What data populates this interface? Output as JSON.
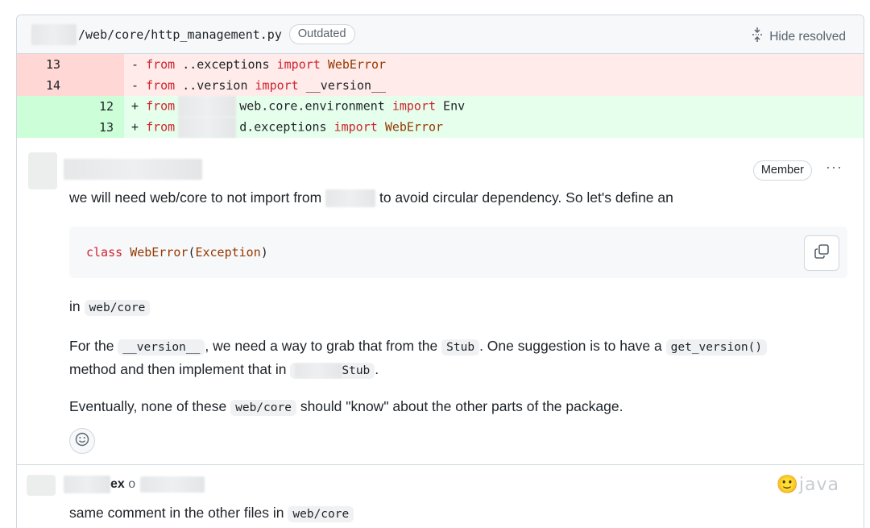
{
  "file": {
    "path": "/web/core/http_management.py",
    "badge": "Outdated",
    "hide_resolved": "Hide resolved"
  },
  "diff": [
    {
      "type": "del",
      "old": "13",
      "new": "",
      "sign": "-",
      "parts": [
        [
          "kw",
          "from"
        ],
        [
          "txt",
          " ..exceptions "
        ],
        [
          "kw",
          "import"
        ],
        [
          "txt",
          " "
        ],
        [
          "tp",
          "WebError"
        ]
      ]
    },
    {
      "type": "del",
      "old": "14",
      "new": "",
      "sign": "-",
      "parts": [
        [
          "kw",
          "from"
        ],
        [
          "txt",
          " ..version "
        ],
        [
          "kw",
          "import"
        ],
        [
          "txt",
          " __version__"
        ]
      ]
    },
    {
      "type": "add",
      "old": "",
      "new": "12",
      "sign": "+",
      "parts": [
        [
          "kw",
          "from"
        ],
        [
          "blur",
          ""
        ],
        [
          "txt",
          "web.core.environment "
        ],
        [
          "kw",
          "import"
        ],
        [
          "txt",
          " Env"
        ]
      ]
    },
    {
      "type": "add",
      "old": "",
      "new": "13",
      "sign": "+",
      "parts": [
        [
          "kw",
          "from"
        ],
        [
          "blur",
          ""
        ],
        [
          "txt",
          "d.exceptions "
        ],
        [
          "kw",
          "import"
        ],
        [
          "txt",
          " "
        ],
        [
          "tp",
          "WebError"
        ]
      ]
    }
  ],
  "comment1": {
    "badge": "Member",
    "more": "···",
    "p1_before": "we will need web/core to not import from",
    "p1_after": "to avoid circular dependency. So let's define an",
    "code_class": "class",
    "code_name": "WebError",
    "code_paren_open": "(",
    "code_exception": "Exception",
    "code_paren_close": ")",
    "p2_in": "in",
    "p2_code": "web/core",
    "p3_a": "For the",
    "p3_code1": "__version__",
    "p3_b": ", we need a way to grab that from the",
    "p3_code2": "Stub",
    "p3_c": ". One suggestion is to have a",
    "p3_code3": "get_version()",
    "p3_d": "method and then implement that in",
    "p3_code4": "Stub",
    "p3_e": ".",
    "p4_a": "Eventually, none of these",
    "p4_code": "web/core",
    "p4_b": "should \"know\" about the other parts of the package."
  },
  "comment2": {
    "author_suffix": "ex",
    "author_on": "o",
    "p1": "same comment in the other files in",
    "p1_code": "web/core"
  },
  "watermark": "🙂java"
}
